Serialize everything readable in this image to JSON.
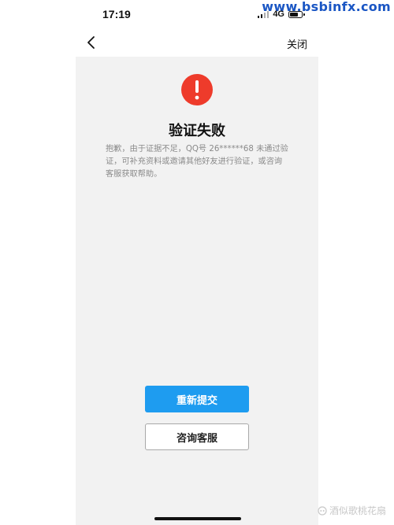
{
  "watermark_top": "www.bsbinfx.com",
  "status_bar": {
    "time": "17:19",
    "network": "4G",
    "battery_level": 0.6
  },
  "nav": {
    "close_label": "关闭"
  },
  "result": {
    "title": "验证失败",
    "description": "抱歉，由于证据不足，QQ号 26******68 未通过验证，可补充资料或邀请其他好友进行验证，或咨询客服获取帮助。",
    "icon_color": "#ee3b2b"
  },
  "actions": {
    "resubmit_label": "重新提交",
    "support_label": "咨询客服",
    "primary_color": "#1e9cf0"
  },
  "watermark_bottom": "酒似歌桃花扇"
}
